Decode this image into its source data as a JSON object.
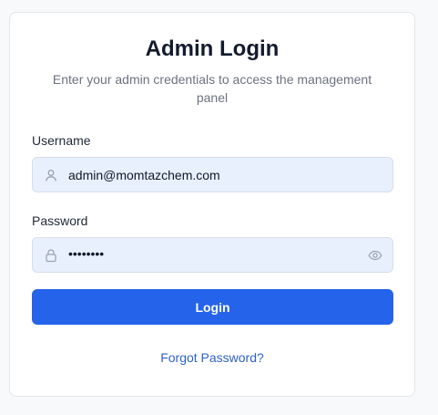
{
  "login": {
    "title": "Admin Login",
    "subtitle": "Enter your admin credentials to access the management panel",
    "username": {
      "label": "Username",
      "value": "admin@momtazchem.com",
      "icon": "user-icon"
    },
    "password": {
      "label": "Password",
      "value": "••••••••",
      "icon": "lock-icon",
      "toggle_icon": "eye-icon"
    },
    "submit_label": "Login",
    "forgot_label": "Forgot Password?"
  },
  "colors": {
    "accent": "#2563eb",
    "link": "#2e62c9",
    "field_bg": "#e8f0fe"
  }
}
